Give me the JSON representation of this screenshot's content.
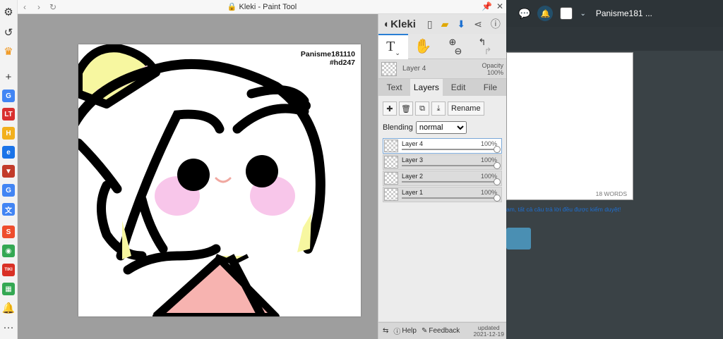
{
  "window": {
    "title": "Kleki - Paint Tool",
    "lock_icon": "lock-icon"
  },
  "sidebar": {
    "items": [
      {
        "name": "settings-icon",
        "glyph": "⚙",
        "color": "#333333"
      },
      {
        "name": "history-icon",
        "glyph": "↺",
        "color": "#333333"
      },
      {
        "name": "crown-icon",
        "glyph": "♛",
        "color": "#f08a00"
      },
      {
        "name": "add-icon",
        "glyph": "+",
        "color": "#333333"
      },
      {
        "name": "google-icon",
        "glyph": "G",
        "color": "#4285f4"
      },
      {
        "name": "lt-icon",
        "glyph": "LT",
        "color": "#d9302f"
      },
      {
        "name": "h-icon",
        "glyph": "H",
        "color": "#f2b01e"
      },
      {
        "name": "edge-icon",
        "glyph": "e",
        "color": "#1a73e8"
      },
      {
        "name": "shield-icon",
        "glyph": "▼",
        "color": "#c23b2a"
      },
      {
        "name": "google-icon-2",
        "glyph": "G",
        "color": "#4285f4"
      },
      {
        "name": "translate-icon",
        "glyph": "文",
        "color": "#4285f4"
      },
      {
        "name": "shopee-icon",
        "glyph": "S",
        "color": "#ee4d2d"
      },
      {
        "name": "chrome-icon",
        "glyph": "◉",
        "color": "#34a853"
      },
      {
        "name": "tiki-icon",
        "glyph": "TIKI",
        "color": "#d93025"
      },
      {
        "name": "calendar-icon",
        "glyph": "▦",
        "color": "#34a853"
      },
      {
        "name": "bell-icon",
        "glyph": "🔔",
        "color": "#333333"
      },
      {
        "name": "more-icon",
        "glyph": "···",
        "color": "#333333"
      }
    ]
  },
  "canvas": {
    "watermark_line1": "Panisme181110",
    "watermark_line2": "#hd247"
  },
  "kleki": {
    "logo": "Kleki",
    "active_layer_name": "Layer 4",
    "opacity_label": "Opacity",
    "opacity_value": "100%",
    "tabs": [
      {
        "label": "Text",
        "active": false
      },
      {
        "label": "Layers",
        "active": true
      },
      {
        "label": "Edit",
        "active": false
      },
      {
        "label": "File",
        "active": false
      }
    ],
    "rename_label": "Rename",
    "blending_label": "Blending",
    "blending_value": "normal",
    "layers": [
      {
        "name": "Layer 4",
        "opacity": "100%",
        "active": true
      },
      {
        "name": "Layer 3",
        "opacity": "100%",
        "active": false
      },
      {
        "name": "Layer 2",
        "opacity": "100%",
        "active": false
      },
      {
        "name": "Layer 1",
        "opacity": "100%",
        "active": false
      }
    ],
    "footer": {
      "help": "Help",
      "feedback": "Feedback",
      "updated_label": "updated",
      "updated_date": "2021-12-19"
    }
  },
  "page": {
    "username": "Panisme181 ...",
    "word_count": "18 WORDS",
    "notice": "am, tất cả câu trả lời đều được kiểm duyệt!"
  }
}
